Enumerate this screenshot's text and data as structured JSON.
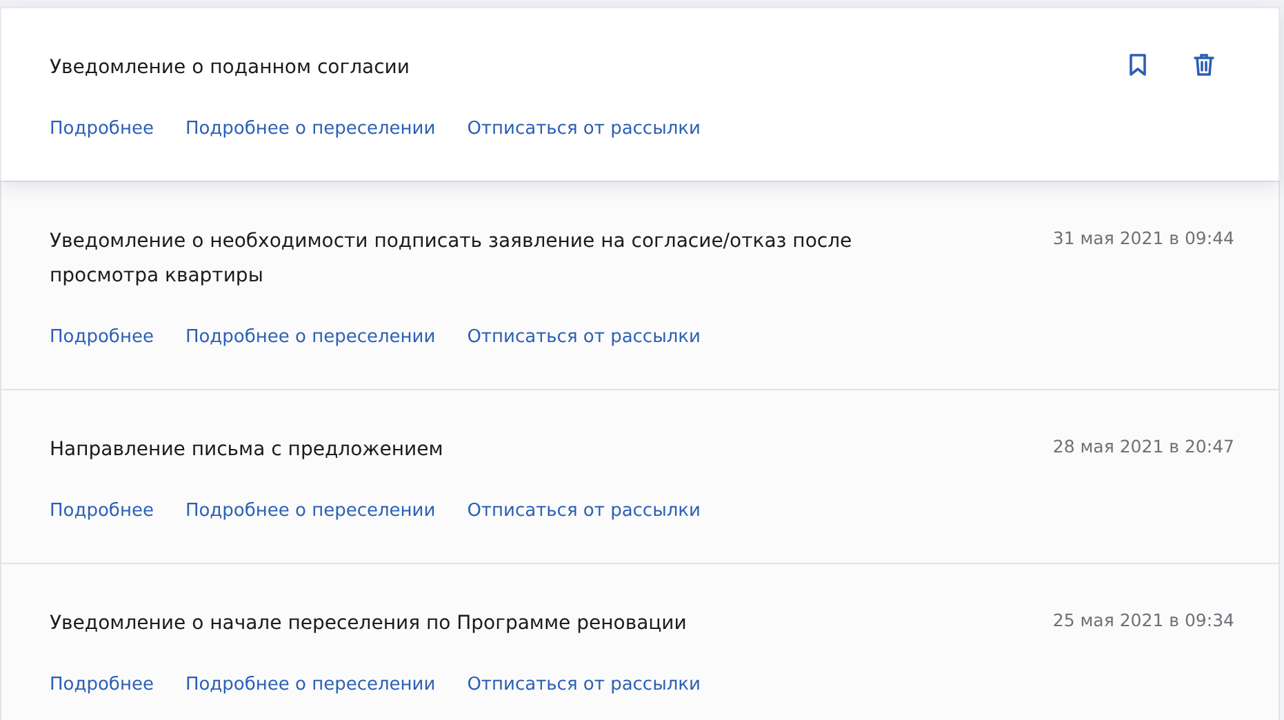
{
  "notifications": [
    {
      "title": "Уведомление о поданном согласии",
      "hovered": true,
      "links": [
        "Подробнее",
        "Подробнее о переселении",
        "Отписаться от рассылки"
      ]
    },
    {
      "title": "Уведомление о необходимости подписать заявление на согласие/отказ после просмотра квартиры",
      "date": "31 мая 2021 в 09:44",
      "hovered": false,
      "links": [
        "Подробнее",
        "Подробнее о переселении",
        "Отписаться от рассылки"
      ]
    },
    {
      "title": "Направление письма с предложением",
      "date": "28 мая 2021 в 20:47",
      "hovered": false,
      "links": [
        "Подробнее",
        "Подробнее о переселении",
        "Отписаться от рассылки"
      ]
    },
    {
      "title": "Уведомление о начале переселения по Программе реновации",
      "date": "25 мая 2021 в 09:34",
      "hovered": false,
      "links": [
        "Подробнее",
        "Подробнее о переселении",
        "Отписаться от рассылки"
      ]
    }
  ]
}
